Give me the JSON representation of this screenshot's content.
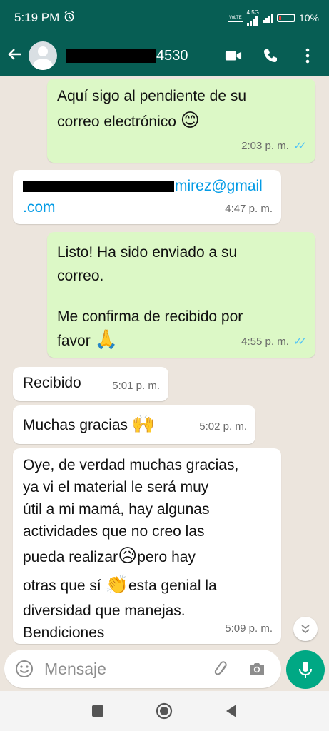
{
  "status_bar": {
    "time": "5:19 PM",
    "network_top": "4.5G",
    "network_sub": "VoLTE",
    "battery_text": "10%",
    "alarm_icon": "alarm-icon"
  },
  "header": {
    "contact_number_visible": "4530",
    "icons": [
      "back-arrow-icon",
      "avatar",
      "video-call-icon",
      "phone-icon",
      "more-options-icon"
    ]
  },
  "messages": [
    {
      "id": "m1",
      "direction": "out",
      "text_lines": [
        "Aquí sigo al pendiente de su",
        "correo electrónico"
      ],
      "emoji": "😊",
      "time": "2:03 p. m.",
      "ticks": "✓✓"
    },
    {
      "id": "m2",
      "direction": "in",
      "line1_visible": "mirez@gmail",
      "line2": ".com",
      "time": "4:47 p. m."
    },
    {
      "id": "m3",
      "direction": "out",
      "text_lines": [
        "Listo! Ha sido enviado a su",
        "correo.",
        "",
        "Me confirma de recibido por",
        "favor"
      ],
      "emoji": "🙏",
      "time": "4:55 p. m.",
      "ticks": "✓✓"
    },
    {
      "id": "m4",
      "direction": "in",
      "text": "Recibido",
      "time": "5:01 p. m."
    },
    {
      "id": "m5",
      "direction": "in",
      "text": "Muchas gracias",
      "emoji": "🙌",
      "time": "5:02 p. m."
    },
    {
      "id": "m6",
      "direction": "in",
      "line1": "Oye, de verdad muchas gracias,",
      "line2": "ya vi el material le será muy",
      "line3": "útil a mi mamá,  hay algunas",
      "line4": "actividades que no creo las",
      "line5a": "pueda realizar",
      "emoji1": "😥",
      "line5b": "pero hay",
      "line6a": "otras que sí",
      "emoji2": "👏",
      "line6b": "esta genial la",
      "line7": "diversidad que manejas.",
      "line8": "Bendiciones",
      "time": "5:09 p. m."
    }
  ],
  "composer": {
    "placeholder": "Mensaje",
    "icons": [
      "emoji-icon",
      "attach-icon",
      "camera-icon",
      "mic-icon"
    ]
  },
  "scroll_button": {
    "glyph": "⌄⌄"
  },
  "nav_bar": {
    "icons": [
      "recents-square-icon",
      "home-circle-icon",
      "back-triangle-icon"
    ]
  },
  "colors": {
    "header": "#075e54",
    "outgoing": "#dcf8c6",
    "incoming": "#ffffff",
    "mic": "#00a884",
    "ticks": "#4fc3f7"
  }
}
